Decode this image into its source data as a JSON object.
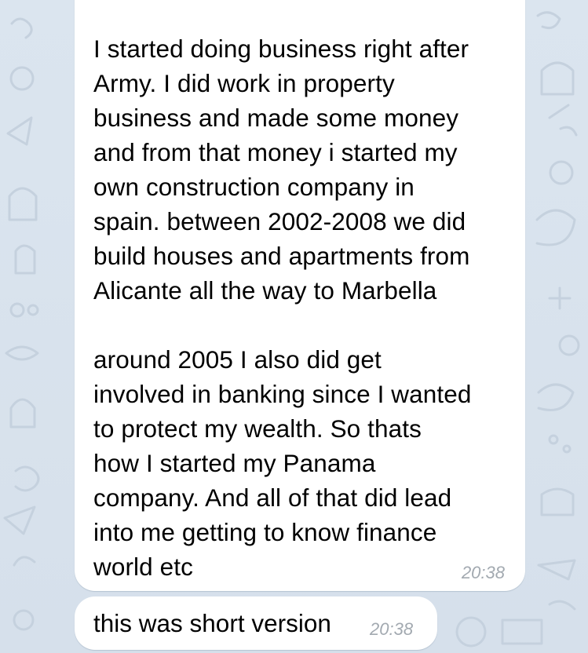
{
  "chat": {
    "messages": [
      {
        "text": "I started doing business right after\nArmy. I did work in property\nbusiness and made some money\nand from that money i started my\nown construction company in\nspain. between 2002-2008 we did\nbuild houses and apartments from\nAlicante all the way to Marbella\n\naround 2005 I also did get\ninvolved in banking since I wanted\nto protect my wealth. So thats\nhow I started my Panama\ncompany. And all of that  did lead\ninto me getting to know finance\nworld etc",
        "time": "20:38"
      },
      {
        "text": "this was short version",
        "time": "20:38"
      }
    ]
  },
  "theme": {
    "wallpaper_color": "#d9e3ee",
    "doodle_color": "#c3cfdc",
    "bubble_color": "#ffffff",
    "time_color": "#a2a9b0"
  }
}
